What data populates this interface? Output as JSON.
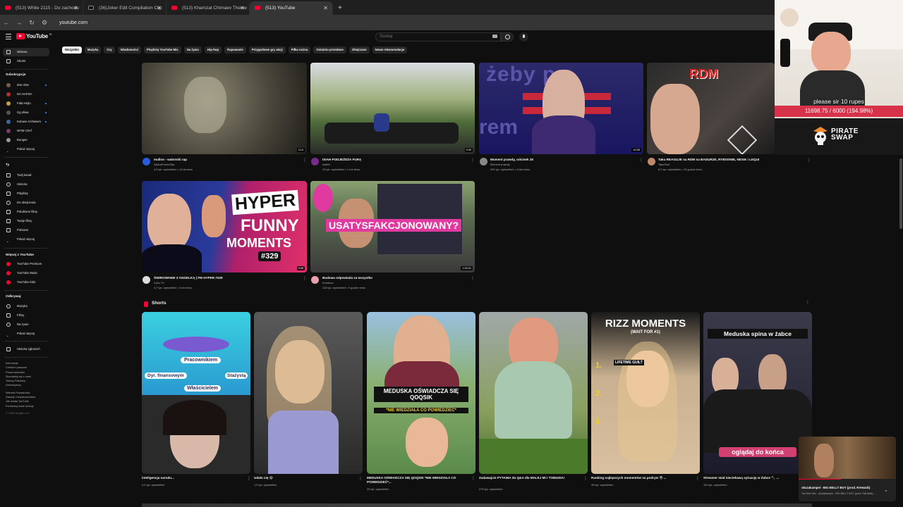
{
  "browser": {
    "tabs": [
      {
        "label": "(513) White 2115 - Do zachodu",
        "icon": "youtube-icon",
        "active": false
      },
      {
        "label": "(36)Joker Edit Compilation Clip",
        "icon": "tiktok-icon",
        "active": false
      },
      {
        "label": "(513) Khamzat Chimaev Theme",
        "icon": "youtube-icon",
        "active": false
      },
      {
        "label": "(513) YouTube",
        "icon": "youtube-icon",
        "active": true
      }
    ],
    "url": "youtube.com"
  },
  "header": {
    "logo": "YouTube",
    "logo_sup": "PL",
    "search_placeholder": "Szukaj"
  },
  "sidebar": {
    "main": [
      {
        "label": "Główna",
        "active": true
      },
      {
        "label": "Shorts",
        "active": false
      }
    ],
    "subs_title": "Subskrypcje",
    "subs": [
      {
        "label": "else else"
      },
      {
        "label": "NA HAPSA"
      },
      {
        "label": "Fala Hejtu"
      },
      {
        "label": "Gg sliwa"
      },
      {
        "label": "Kulowe Archiwum"
      },
      {
        "label": "WYM Chef"
      },
      {
        "label": "Bungee"
      },
      {
        "label": "Pokaż więcej"
      }
    ],
    "you_title": "Ty",
    "you": [
      {
        "label": "Twój kanał"
      },
      {
        "label": "Historia"
      },
      {
        "label": "Playlisty"
      },
      {
        "label": "Do obejrzenia"
      },
      {
        "label": "Polubione filmy"
      },
      {
        "label": "Twoje filmy"
      },
      {
        "label": "Pobrane"
      },
      {
        "label": "Pokaż więcej"
      }
    ],
    "more_title": "Więcej z YouTube",
    "more": [
      {
        "label": "YouTube Premium"
      },
      {
        "label": "YouTube Music"
      },
      {
        "label": "YouTube Kids"
      }
    ],
    "explore_title": "Odkrywaj",
    "explore": [
      {
        "label": "Muzyka"
      },
      {
        "label": "Filmy"
      },
      {
        "label": "Na żywo"
      },
      {
        "label": "Pokaż więcej"
      }
    ],
    "report": "Historia zgłoszeń",
    "footer1": "Informacje",
    "footer2": "Centrum prasowe",
    "footer3": "Prawa autorskie",
    "footer4": "Skontaktuj się z nami",
    "footer5": "Twórcy  Reklamy",
    "footer6": "Deweloperzy",
    "footer7": "Warunki  Prywatność",
    "footer8": "Zasady i bezpieczeństwo",
    "footer9": "Jak działa YouTube",
    "footer10": "Przetestuj nowe funkcje",
    "copyright": "© 2025 Google LLC"
  },
  "chips": [
    "Wszystko",
    "Muzyka",
    "Gry",
    "Wiadomości",
    "Playlisty YouTube Mix",
    "Na żywo",
    "Hip-hop",
    "Rapowanie",
    "Przygodowe gry akcji",
    "Piłka nożna",
    "Ostatnio przesłane",
    "Obejrzane",
    "Nowe rekomendacje"
  ],
  "videos": [
    {
      "title": "mullon - walonski rap",
      "channel": "WalonPromoRap",
      "meta": "4,8 tys. wyświetleń • 14 lat temu",
      "duration": "3:13"
    },
    {
      "title": "ISIAH PODJEŻDŻA FURĄ",
      "channel": "Isiahtv",
      "meta": "33 tys. wyświetleń • 1 rok temu",
      "duration": "0:30"
    },
    {
      "title": "Moment prawdy, odcinek 25",
      "channel": "Moment prawdy",
      "meta": "226 tys. wyświetleń • 4 lata temu",
      "duration": "43:35"
    },
    {
      "title": "Taku REAGUJE na RDM na BADURZE, RYBSONIE, NEXIE i LEQUI",
      "channel": "TakuShot",
      "meta": "8,2 tys. wyświetleń • 19 godzin temu",
      "duration": ""
    },
    {
      "title": "ŚWIROWANIE Z ANGELKĄ | FM HYPER #329",
      "channel": "Cyku TV",
      "meta": "4,7 tys. wyświetleń • 3 dni temu",
      "duration": "9:08"
    },
    {
      "title": "Budowa odpowiada za wszystko",
      "channel": "Koniburo",
      "meta": "118 tys. wyświetleń • 9 godzin temu",
      "duration": "1:00:21"
    }
  ],
  "thumb_text": {
    "v3": "żeby p",
    "v3b": "rem",
    "rdm": "RDM",
    "hyper1": "HYPER",
    "hyper2": "FUNNY",
    "hyper3": "MOMENTS",
    "hyper4": "#329",
    "usat": "USATYSFAKCJONOWANY?"
  },
  "shorts": {
    "title": "Shorts",
    "items": [
      {
        "title": "inteligencja narodu...",
        "meta": "4,4 tys. wyświetleń",
        "labels": [
          "Pracownikiem",
          "Dyr. finansowym",
          "Stażystą",
          "Właścicielem"
        ]
      },
      {
        "title": "Udało się 😄",
        "meta": "1,9 tys. wyświetleń"
      },
      {
        "title": "MEDUSKA OŚWIADCZA SIĘ QOQSIK *NIE WIEDZIAŁA CO POWIEDZIEĆ*...",
        "meta": "23 tys. wyświetleń",
        "caption1": "MEDUSKA OŚWIADCZA SIĘ QOQSIK",
        "caption2": "*NIE WIEDZIAŁA CO POWIEDZIEĆ*"
      },
      {
        "title": "Zadawajcie PYTANIA do Q&A dla MALEJ MI i TOMUSIA!",
        "meta": "278 tys. wyświetleń"
      },
      {
        "title": "Ranking najlepszych momentów na podryw 😳 ...",
        "meta": "49 tys. wyświetleń",
        "caption1": "RIZZ MOMENTS",
        "caption2": "(WAIT FOR #1)",
        "caption3": "LIFETIME GUILT"
      },
      {
        "title": "Streamer miał nieciekawą sytuację w Żabce 🔨 ...",
        "meta": "109 tys. wyświetleń",
        "caption1": "Meduska spina w żabce",
        "caption2": "oglądaj do końca"
      }
    ]
  },
  "overlay": {
    "donation_msg": "please sir 10 rupes",
    "donation_progress": "11698.75 / 6000 (194.98%)",
    "brand1": "PIRATE",
    "brand2": "SWAP",
    "mini_title": "okuzakampel - BIG BELLY BOY (prod. RAHasik)",
    "mini_sub": "YouTube Mix - okuzakampel - BIG BELLY BOY (prod. RAHasik), ..."
  },
  "colors": {
    "accent": "#ff0033",
    "donation_bar": "#d8324a",
    "bg": "#0f0f0f"
  }
}
